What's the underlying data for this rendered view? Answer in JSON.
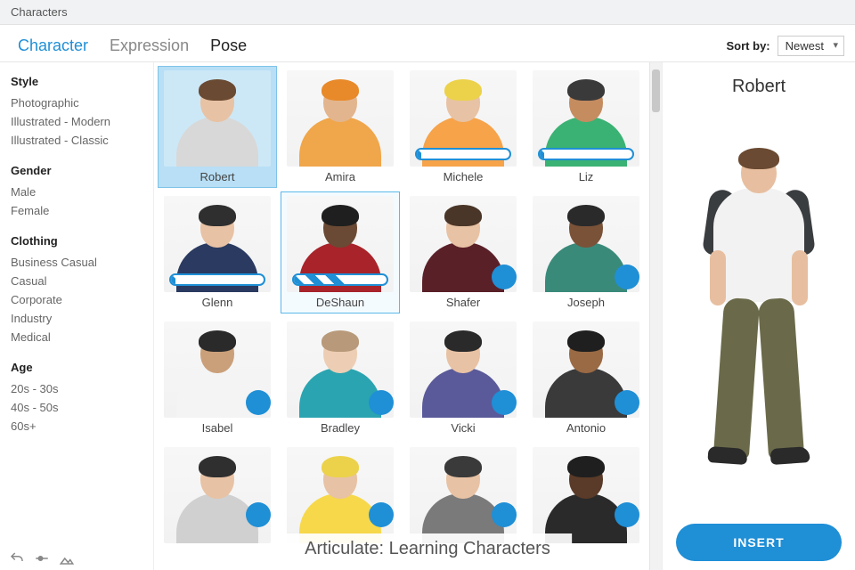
{
  "window": {
    "title": "Characters"
  },
  "tabs": [
    {
      "label": "Character",
      "state": "active"
    },
    {
      "label": "Expression",
      "state": "inactive"
    },
    {
      "label": "Pose",
      "state": "dark"
    }
  ],
  "sort": {
    "label": "Sort by:",
    "selected": "Newest"
  },
  "filters": [
    {
      "heading": "Style",
      "items": [
        "Photographic",
        "Illustrated - Modern",
        "Illustrated - Classic"
      ]
    },
    {
      "heading": "Gender",
      "items": [
        "Male",
        "Female"
      ]
    },
    {
      "heading": "Clothing",
      "items": [
        "Business Casual",
        "Casual",
        "Corporate",
        "Industry",
        "Medical"
      ]
    },
    {
      "heading": "Age",
      "items": [
        "20s - 30s",
        "40s - 50s",
        "60s+"
      ]
    }
  ],
  "characters": [
    {
      "name": "Robert",
      "selected": true,
      "status": "downloaded",
      "skin": "#e8c2a4",
      "hair": "#6a4a32",
      "shirt": "#d8d8d8"
    },
    {
      "name": "Amira",
      "selected": false,
      "status": "downloaded",
      "skin": "#e2b58e",
      "hair": "#e88a2a",
      "shirt": "#f0a64a"
    },
    {
      "name": "Michele",
      "selected": false,
      "status": "loading",
      "progress": 5,
      "skin": "#e8c2a4",
      "hair": "#ecd24a",
      "shirt": "#f6a34a"
    },
    {
      "name": "Liz",
      "selected": false,
      "status": "loading",
      "progress": 5,
      "skin": "#c58c60",
      "hair": "#3a3a3a",
      "shirt": "#3ab273"
    },
    {
      "name": "Glenn",
      "selected": false,
      "status": "loading",
      "progress": 5,
      "skin": "#e8c2a4",
      "hair": "#2f2f2f",
      "shirt": "#2a3a60"
    },
    {
      "name": "DeShaun",
      "selected": false,
      "status": "loading",
      "progress": 55,
      "hover": true,
      "skin": "#6a4a34",
      "hair": "#1f1f1f",
      "shirt": "#a8232a"
    },
    {
      "name": "Shafer",
      "selected": false,
      "status": "downloadable",
      "skin": "#e8c2a4",
      "hair": "#4a3628",
      "shirt": "#5a2028"
    },
    {
      "name": "Joseph",
      "selected": false,
      "status": "downloadable",
      "skin": "#7a5238",
      "hair": "#2a2a2a",
      "shirt": "#3a8a7a"
    },
    {
      "name": "Isabel",
      "selected": false,
      "status": "downloadable",
      "skin": "#caa07a",
      "hair": "#2a2a2a",
      "shirt": "#f4f4f4"
    },
    {
      "name": "Bradley",
      "selected": false,
      "status": "downloadable",
      "skin": "#edceb4",
      "hair": "#b89a7a",
      "shirt": "#2aa4b0"
    },
    {
      "name": "Vicki",
      "selected": false,
      "status": "downloadable",
      "skin": "#e8c2a4",
      "hair": "#2a2a2a",
      "shirt": "#5a5a9a"
    },
    {
      "name": "Antonio",
      "selected": false,
      "status": "downloadable",
      "skin": "#9a6a44",
      "hair": "#1f1f1f",
      "shirt": "#3a3a3a"
    },
    {
      "name": "",
      "selected": false,
      "status": "downloadable",
      "skin": "#e8c2a4",
      "hair": "#2f2f2f",
      "shirt": "#d0d0d0"
    },
    {
      "name": "",
      "selected": false,
      "status": "downloadable",
      "skin": "#e8c2a4",
      "hair": "#ecd24a",
      "shirt": "#f6d84a"
    },
    {
      "name": "",
      "selected": false,
      "status": "downloadable",
      "skin": "#e8c2a4",
      "hair": "#3a3a3a",
      "shirt": "#7a7a7a"
    },
    {
      "name": "",
      "selected": false,
      "status": "downloadable",
      "skin": "#5a3a28",
      "hair": "#1f1f1f",
      "shirt": "#2a2a2a"
    }
  ],
  "preview": {
    "name": "Robert",
    "insert_label": "INSERT"
  },
  "caption": "Articulate: Learning Characters"
}
